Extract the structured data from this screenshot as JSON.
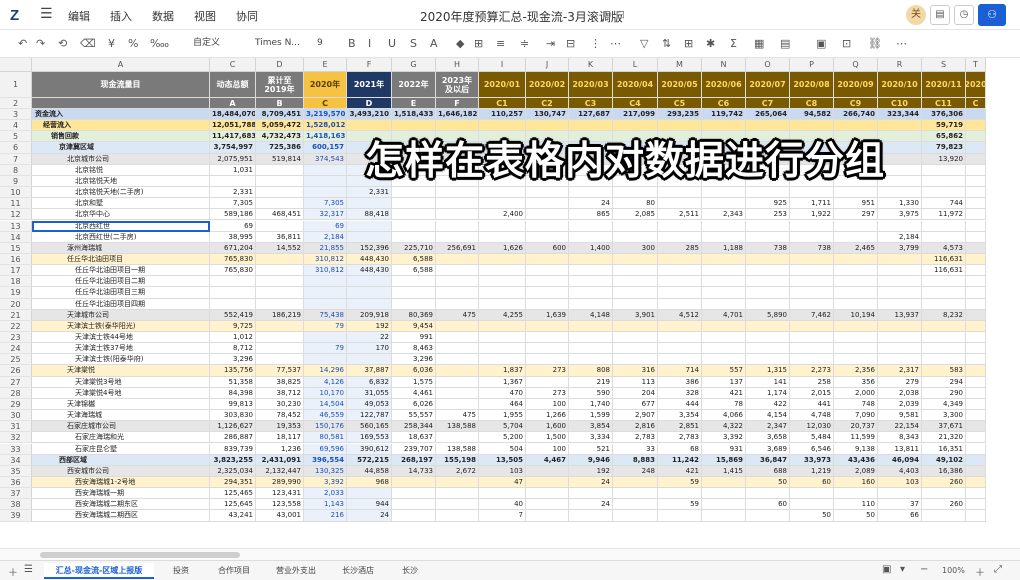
{
  "app": {
    "logo": "Z",
    "title": "2020年度预算汇总-现金流-3月滚调版",
    "menus": [
      "编辑",
      "插入",
      "数据",
      "视图",
      "协同"
    ],
    "user_initial": "关"
  },
  "toolbar": {
    "format": "自定义",
    "font": "Times N...",
    "size": "9",
    "items": [
      "↶",
      "↷",
      "⟲",
      "⌫",
      "¥",
      "%",
      "‱",
      "B",
      "I",
      "U",
      "S",
      "A",
      "◆",
      "⊞",
      "≡",
      "≑",
      "⇥",
      "⊟",
      "⋮",
      "⋯",
      "▽",
      "⇅",
      "⊞",
      "✱",
      "Σ",
      "▦",
      "▤",
      "▣",
      "⊡",
      "⛓",
      "⋯"
    ]
  },
  "columns": [
    {
      "letter": "A",
      "w": 178
    },
    {
      "letter": "C",
      "w": 46
    },
    {
      "letter": "D",
      "w": 48
    },
    {
      "letter": "E",
      "w": 43
    },
    {
      "letter": "F",
      "w": 45
    },
    {
      "letter": "G",
      "w": 44
    },
    {
      "letter": "H",
      "w": 43
    },
    {
      "letter": "I",
      "w": 47
    },
    {
      "letter": "J",
      "w": 43
    },
    {
      "letter": "K",
      "w": 44
    },
    {
      "letter": "L",
      "w": 45
    },
    {
      "letter": "M",
      "w": 44
    },
    {
      "letter": "N",
      "w": 44
    },
    {
      "letter": "O",
      "w": 44
    },
    {
      "letter": "P",
      "w": 44
    },
    {
      "letter": "Q",
      "w": 44
    },
    {
      "letter": "R",
      "w": 44
    },
    {
      "letter": "S",
      "w": 44
    },
    {
      "letter": "T",
      "w": 20
    }
  ],
  "header_row1": [
    "现金流量目",
    "动态总额",
    "累计至2019年",
    "2020年",
    "2021年",
    "2022年",
    "2023年及以后",
    "2020/01",
    "2020/02",
    "2020/03",
    "2020/04",
    "2020/05",
    "2020/06",
    "2020/07",
    "2020/08",
    "2020/09",
    "2020/10",
    "2020/11",
    "2020"
  ],
  "header_row2": [
    "",
    "A",
    "B",
    "C",
    "D",
    "E",
    "F",
    "C1",
    "C2",
    "C3",
    "C4",
    "C5",
    "C6",
    "C7",
    "C8",
    "C9",
    "C10",
    "C11",
    "C"
  ],
  "rows": [
    {
      "n": "3",
      "indent": 0,
      "bg": "#c9d9ef",
      "bold": true,
      "label": "资金流入",
      "v": [
        "18,484,070",
        "8,709,451",
        "3,219,570",
        "3,493,210",
        "1,518,433",
        "1,646,182",
        "110,257",
        "130,747",
        "127,687",
        "217,099",
        "293,235",
        "119,742",
        "265,064",
        "94,582",
        "266,740",
        "323,344",
        "376,306",
        ""
      ]
    },
    {
      "n": "4",
      "indent": 1,
      "bg": "#ffe699",
      "bold": true,
      "label": "经营流入",
      "v": [
        "12,051,788",
        "5,059,472",
        "1,528,012",
        "",
        "",
        "",
        "",
        "",
        "",
        "",
        "",
        "",
        "",
        "",
        "",
        "",
        "59,719",
        ""
      ]
    },
    {
      "n": "5",
      "indent": 2,
      "bg": "#e2efda",
      "bold": true,
      "label": "销售回款",
      "v": [
        "11,417,683",
        "4,732,473",
        "1,418,163",
        "",
        "",
        "",
        "",
        "",
        "",
        "",
        "",
        "",
        "",
        "",
        "",
        "",
        "65,862",
        ""
      ]
    },
    {
      "n": "6",
      "indent": 3,
      "bg": "#dde8f6",
      "bold": true,
      "label": "京津冀区域",
      "v": [
        "3,754,997",
        "725,386",
        "600,157",
        "",
        "",
        "",
        "",
        "",
        "",
        "",
        "",
        "",
        "",
        "",
        "",
        "",
        "79,823",
        ""
      ]
    },
    {
      "n": "7",
      "indent": 4,
      "bg": "#e6e6e6",
      "bold": false,
      "label": "北京城市公司",
      "v": [
        "2,075,951",
        "519,814",
        "374,543",
        "",
        "",
        "",
        "",
        "",
        "",
        "",
        "",
        "",
        "",
        "",
        "",
        "",
        "13,920",
        ""
      ]
    },
    {
      "n": "8",
      "indent": 5,
      "bg": "#ffffff",
      "bold": false,
      "label": "北京铭悦",
      "v": [
        "1,031",
        "",
        "",
        "1,031",
        "",
        "",
        "",
        "",
        "",
        "",
        "",
        "",
        "",
        "",
        "",
        "",
        "",
        ""
      ]
    },
    {
      "n": "9",
      "indent": 5,
      "bg": "#ffffff",
      "bold": false,
      "label": "北京铭悦天地",
      "v": [
        "",
        "",
        "",
        "",
        "",
        "",
        "",
        "",
        "",
        "",
        "",
        "",
        "",
        "",
        "",
        "",
        "",
        ""
      ]
    },
    {
      "n": "10",
      "indent": 5,
      "bg": "#ffffff",
      "bold": false,
      "label": "北京铭悦天地(二手房)",
      "v": [
        "2,331",
        "",
        "",
        "2,331",
        "",
        "",
        "",
        "",
        "",
        "",
        "",
        "",
        "",
        "",
        "",
        "",
        "",
        ""
      ]
    },
    {
      "n": "11",
      "indent": 5,
      "bg": "#ffffff",
      "bold": false,
      "label": "北京和墅",
      "v": [
        "7,305",
        "",
        "7,305",
        "",
        "",
        "",
        "",
        "",
        "24",
        "80",
        "",
        "",
        "925",
        "1,711",
        "951",
        "1,330",
        "744",
        ""
      ]
    },
    {
      "n": "12",
      "indent": 5,
      "bg": "#ffffff",
      "bold": false,
      "label": "北京华中心",
      "v": [
        "589,186",
        "468,451",
        "32,317",
        "88,418",
        "",
        "",
        "2,400",
        "",
        "865",
        "2,085",
        "2,511",
        "2,343",
        "253",
        "1,922",
        "297",
        "3,975",
        "11,972",
        ""
      ]
    },
    {
      "n": "13",
      "indent": 5,
      "bg": "#ffffff",
      "bold": false,
      "label": "北京西红世",
      "v": [
        "69",
        "",
        "69",
        "",
        "",
        "",
        "",
        "",
        "",
        "",
        "",
        "",
        "",
        "",
        "",
        "",
        "",
        ""
      ]
    },
    {
      "n": "14",
      "indent": 5,
      "bg": "#ffffff",
      "bold": false,
      "label": "北京西红世(二手房)",
      "v": [
        "38,995",
        "36,811",
        "2,184",
        "",
        "",
        "",
        "",
        "",
        "",
        "",
        "",
        "",
        "",
        "",
        "",
        "2,184",
        "",
        ""
      ]
    },
    {
      "n": "15",
      "indent": 4,
      "bg": "#e6e6e6",
      "bold": false,
      "label": "涿州海瑞城",
      "v": [
        "671,204",
        "14,552",
        "21,855",
        "152,396",
        "225,710",
        "256,691",
        "1,626",
        "600",
        "1,400",
        "300",
        "285",
        "1,188",
        "738",
        "738",
        "2,465",
        "3,799",
        "4,573",
        ""
      ]
    },
    {
      "n": "16",
      "indent": 4,
      "bg": "#fff2cc",
      "bold": false,
      "label": "任丘华北油田项目",
      "v": [
        "765,830",
        "",
        "310,812",
        "448,430",
        "6,588",
        "",
        "",
        "",
        "",
        "",
        "",
        "",
        "",
        "",
        "",
        "",
        "116,631",
        ""
      ]
    },
    {
      "n": "17",
      "indent": 5,
      "bg": "#ffffff",
      "bold": false,
      "label": "任丘华北油田项目一期",
      "v": [
        "765,830",
        "",
        "310,812",
        "448,430",
        "6,588",
        "",
        "",
        "",
        "",
        "",
        "",
        "",
        "",
        "",
        "",
        "",
        "116,631",
        ""
      ]
    },
    {
      "n": "18",
      "indent": 5,
      "bg": "#ffffff",
      "bold": false,
      "label": "任丘华北油田项目二期",
      "v": [
        "",
        "",
        "",
        "",
        "",
        "",
        "",
        "",
        "",
        "",
        "",
        "",
        "",
        "",
        "",
        "",
        "",
        ""
      ]
    },
    {
      "n": "19",
      "indent": 5,
      "bg": "#ffffff",
      "bold": false,
      "label": "任丘华北油田项目三期",
      "v": [
        "",
        "",
        "",
        "",
        "",
        "",
        "",
        "",
        "",
        "",
        "",
        "",
        "",
        "",
        "",
        "",
        "",
        ""
      ]
    },
    {
      "n": "20",
      "indent": 5,
      "bg": "#ffffff",
      "bold": false,
      "label": "任丘华北油田项目四期",
      "v": [
        "",
        "",
        "",
        "",
        "",
        "",
        "",
        "",
        "",
        "",
        "",
        "",
        "",
        "",
        "",
        "",
        "",
        ""
      ]
    },
    {
      "n": "21",
      "indent": 4,
      "bg": "#e6e6e6",
      "bold": false,
      "label": "天津城市公司",
      "v": [
        "552,419",
        "186,219",
        "75,438",
        "209,918",
        "80,369",
        "475",
        "4,255",
        "1,639",
        "4,148",
        "3,901",
        "4,512",
        "4,701",
        "5,890",
        "7,462",
        "10,194",
        "13,937",
        "8,232",
        ""
      ]
    },
    {
      "n": "22",
      "indent": 4,
      "bg": "#fff2cc",
      "bold": false,
      "label": "天津滨士铁(泰华阳光)",
      "v": [
        "9,725",
        "",
        "79",
        "192",
        "9,454",
        "",
        "",
        "",
        "",
        "",
        "",
        "",
        "",
        "",
        "",
        "",
        "",
        ""
      ]
    },
    {
      "n": "23",
      "indent": 5,
      "bg": "#ffffff",
      "bold": false,
      "label": "天津滨士铁44号地",
      "v": [
        "1,012",
        "",
        "",
        "22",
        "991",
        "",
        "",
        "",
        "",
        "",
        "",
        "",
        "",
        "",
        "",
        "",
        "",
        ""
      ]
    },
    {
      "n": "24",
      "indent": 5,
      "bg": "#ffffff",
      "bold": false,
      "label": "天津滨士铁37号地",
      "v": [
        "8,712",
        "",
        "79",
        "170",
        "8,463",
        "",
        "",
        "",
        "",
        "",
        "",
        "",
        "",
        "",
        "",
        "",
        "",
        ""
      ]
    },
    {
      "n": "25",
      "indent": 5,
      "bg": "#ffffff",
      "bold": false,
      "label": "天津滨士铁(阳泰华府)",
      "v": [
        "3,296",
        "",
        "",
        "",
        "3,296",
        "",
        "",
        "",
        "",
        "",
        "",
        "",
        "",
        "",
        "",
        "",
        "",
        ""
      ]
    },
    {
      "n": "26",
      "indent": 4,
      "bg": "#fff2cc",
      "bold": false,
      "label": "天津棠悦",
      "v": [
        "135,756",
        "77,537",
        "14,296",
        "37,887",
        "6,036",
        "",
        "1,837",
        "273",
        "808",
        "316",
        "714",
        "557",
        "1,315",
        "2,273",
        "2,356",
        "2,317",
        "583",
        ""
      ]
    },
    {
      "n": "27",
      "indent": 5,
      "bg": "#ffffff",
      "bold": false,
      "label": "天津棠悦3号地",
      "v": [
        "51,358",
        "38,825",
        "4,126",
        "6,832",
        "1,575",
        "",
        "1,367",
        "",
        "219",
        "113",
        "386",
        "137",
        "141",
        "258",
        "356",
        "279",
        "294",
        ""
      ]
    },
    {
      "n": "28",
      "indent": 5,
      "bg": "#ffffff",
      "bold": false,
      "label": "天津棠悦4号地",
      "v": [
        "84,398",
        "38,712",
        "10,170",
        "31,055",
        "4,461",
        "",
        "470",
        "273",
        "590",
        "204",
        "328",
        "421",
        "1,174",
        "2,015",
        "2,000",
        "2,038",
        "290",
        ""
      ]
    },
    {
      "n": "29",
      "indent": 4,
      "bg": "#ffffff",
      "bold": false,
      "label": "天津锦樾",
      "v": [
        "99,813",
        "30,230",
        "14,504",
        "49,053",
        "6,026",
        "",
        "464",
        "100",
        "1,740",
        "677",
        "444",
        "78",
        "422",
        "441",
        "748",
        "2,039",
        "4,349",
        ""
      ]
    },
    {
      "n": "30",
      "indent": 4,
      "bg": "#ffffff",
      "bold": false,
      "label": "天津海瑞城",
      "v": [
        "303,830",
        "78,452",
        "46,559",
        "122,787",
        "55,557",
        "475",
        "1,955",
        "1,266",
        "1,599",
        "2,907",
        "3,354",
        "4,066",
        "4,154",
        "4,748",
        "7,090",
        "9,581",
        "3,300",
        ""
      ]
    },
    {
      "n": "31",
      "indent": 4,
      "bg": "#e6e6e6",
      "bold": false,
      "label": "石家庄城市公司",
      "v": [
        "1,126,627",
        "19,353",
        "150,176",
        "560,165",
        "258,344",
        "138,588",
        "5,704",
        "1,600",
        "3,854",
        "2,816",
        "2,851",
        "4,322",
        "2,347",
        "12,030",
        "20,737",
        "22,154",
        "37,671",
        ""
      ]
    },
    {
      "n": "32",
      "indent": 5,
      "bg": "#ffffff",
      "bold": false,
      "label": "石家庄海瑞和光",
      "v": [
        "286,887",
        "18,117",
        "80,581",
        "169,553",
        "18,637",
        "",
        "5,200",
        "1,500",
        "3,334",
        "2,783",
        "2,783",
        "3,392",
        "3,658",
        "5,484",
        "11,599",
        "8,343",
        "21,320",
        ""
      ]
    },
    {
      "n": "33",
      "indent": 5,
      "bg": "#ffffff",
      "bold": false,
      "label": "石家庄昆仑墅",
      "v": [
        "839,739",
        "1,236",
        "69,596",
        "390,612",
        "239,707",
        "138,588",
        "504",
        "100",
        "521",
        "33",
        "68",
        "931",
        "3,689",
        "6,546",
        "9,138",
        "13,811",
        "16,351",
        ""
      ]
    },
    {
      "n": "34",
      "indent": 3,
      "bg": "#dde8f6",
      "bold": true,
      "label": "西部区域",
      "v": [
        "3,823,255",
        "2,431,091",
        "396,554",
        "572,215",
        "268,197",
        "155,198",
        "13,505",
        "4,467",
        "9,946",
        "8,883",
        "11,242",
        "15,869",
        "36,847",
        "33,973",
        "43,436",
        "46,094",
        "49,102",
        ""
      ]
    },
    {
      "n": "35",
      "indent": 4,
      "bg": "#e6e6e6",
      "bold": false,
      "label": "西安城市公司",
      "v": [
        "2,325,034",
        "2,132,447",
        "130,325",
        "44,858",
        "14,733",
        "2,672",
        "103",
        "",
        "192",
        "248",
        "421",
        "1,415",
        "688",
        "1,219",
        "2,089",
        "4,403",
        "16,386",
        ""
      ]
    },
    {
      "n": "36",
      "indent": 5,
      "bg": "#fff2cc",
      "bold": false,
      "label": "西安海瑞城1-2号地",
      "v": [
        "294,351",
        "289,990",
        "3,392",
        "968",
        "",
        "",
        "47",
        "",
        "24",
        "",
        "59",
        "",
        "50",
        "60",
        "160",
        "103",
        "260",
        ""
      ]
    },
    {
      "n": "37",
      "indent": 5,
      "bg": "#ffffff",
      "bold": false,
      "label": "西安海瑞城一期",
      "v": [
        "125,465",
        "123,431",
        "2,033",
        "",
        "",
        "",
        "",
        "",
        "",
        "",
        "",
        "",
        "",
        "",
        "",
        "",
        "",
        ""
      ]
    },
    {
      "n": "38",
      "indent": 5,
      "bg": "#ffffff",
      "bold": false,
      "label": "西安海瑞城二期东区",
      "v": [
        "125,645",
        "123,558",
        "1,143",
        "944",
        "",
        "",
        "40",
        "",
        "24",
        "",
        "59",
        "",
        "60",
        "",
        "110",
        "37",
        "260",
        ""
      ]
    },
    {
      "n": "39",
      "indent": 5,
      "bg": "#ffffff",
      "bold": false,
      "label": "西安海瑞城二期西区",
      "v": [
        "43,241",
        "43,001",
        "216",
        "24",
        "",
        "",
        "7",
        "",
        "",
        "",
        "",
        "",
        "",
        "50",
        "50",
        "66",
        "",
        ""
      ]
    }
  ],
  "overlay_text": "怎样在表格内对数据进行分组",
  "sheets": [
    {
      "label": "汇总-现金流-区域上报版",
      "active": true
    },
    {
      "label": "投资",
      "active": false
    },
    {
      "label": "合作项目",
      "active": false
    },
    {
      "label": "营业外支出",
      "active": false
    },
    {
      "label": "长沙酒店",
      "active": false
    },
    {
      "label": "长沙",
      "active": false
    }
  ],
  "zoom": "100%"
}
